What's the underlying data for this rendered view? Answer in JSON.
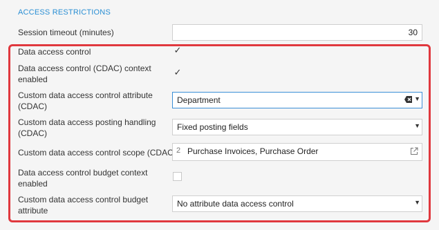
{
  "section": {
    "title": "ACCESS RESTRICTIONS"
  },
  "fields": {
    "session_timeout": {
      "label": "Session timeout (minutes)",
      "value": "30"
    },
    "data_access_control": {
      "label": "Data access control",
      "checked": true
    },
    "cdac_context": {
      "label_line1": "Data access control (CDAC) context",
      "label_line2": "enabled",
      "checked": true
    },
    "cdac_attribute": {
      "label_line1": "Custom data access control attribute",
      "label_line2": "(CDAC)",
      "value": "Department"
    },
    "cdac_posting": {
      "label_line1": "Custom data access posting handling",
      "label_line2": "(CDAC)",
      "value": "Fixed posting fields"
    },
    "cdac_scope": {
      "label": "Custom data access control scope (CDAC)",
      "count": "2",
      "value": "Purchase Invoices, Purchase Order"
    },
    "budget_context": {
      "label_line1": "Data access control budget context",
      "label_line2": "enabled",
      "checked": false
    },
    "budget_attribute": {
      "label_line1": "Custom data access control budget",
      "label_line2": "attribute",
      "value": "No attribute data access control"
    }
  },
  "glyphs": {
    "check": "✓",
    "dropdown": "▼"
  },
  "colors": {
    "accent": "#2a8fd4",
    "highlight": "#e0383e",
    "focus": "#3a8ed6"
  }
}
